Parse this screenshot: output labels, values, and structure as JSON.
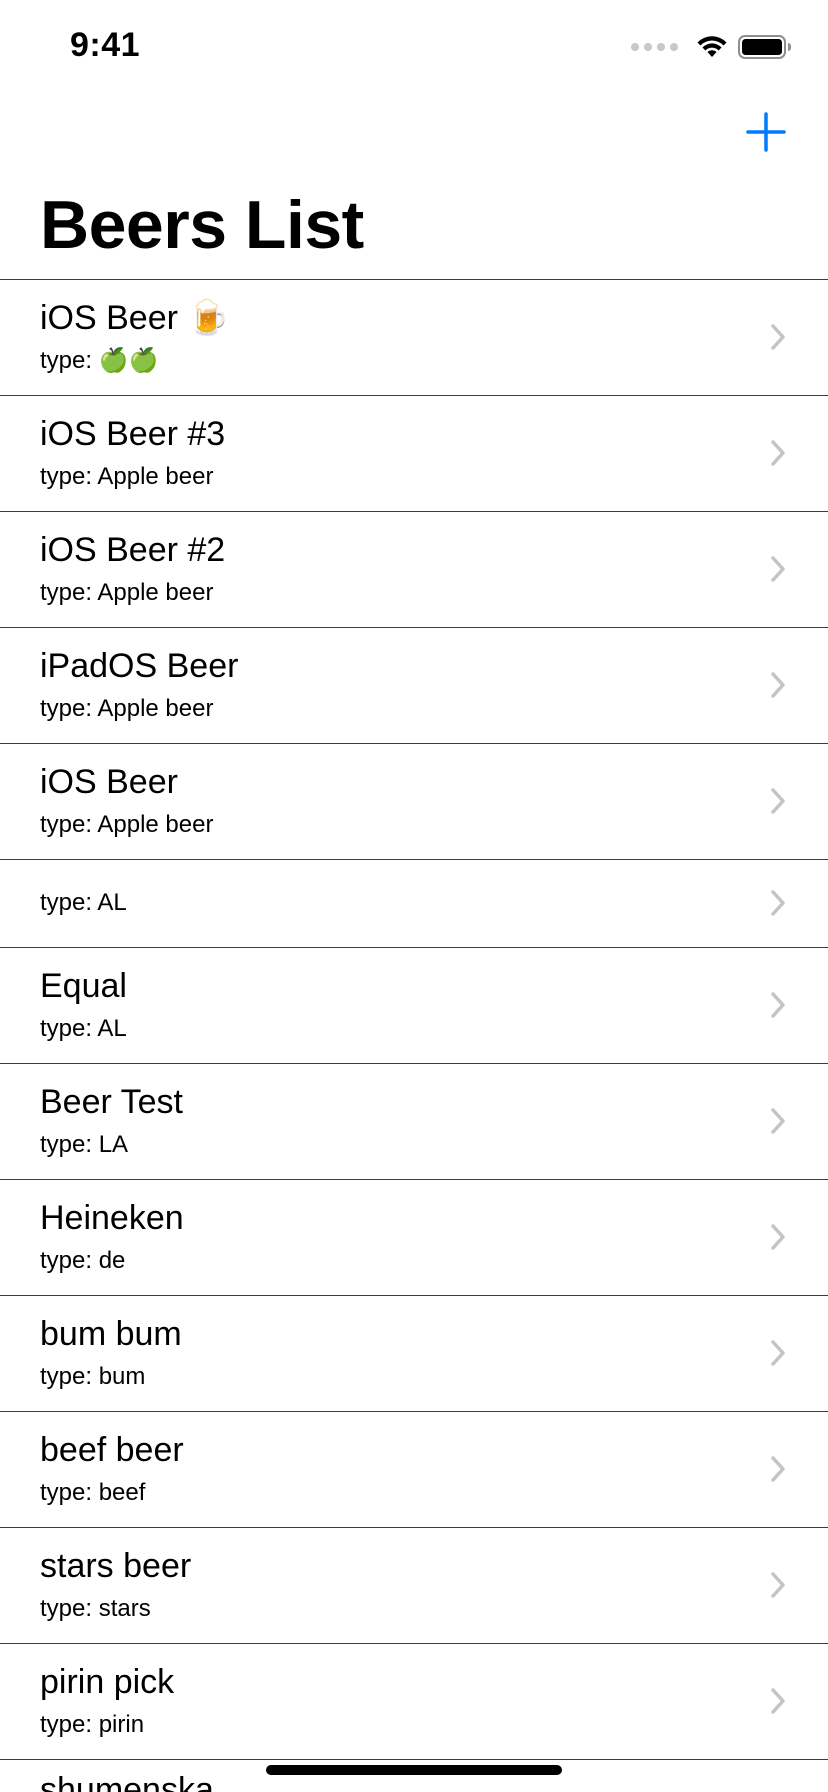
{
  "status_bar": {
    "time": "9:41"
  },
  "nav": {
    "title": "Beers List",
    "add_icon": "plus-icon",
    "accent_color": "#007aff"
  },
  "list": {
    "items": [
      {
        "title": "iOS Beer 🍺",
        "subtitle": "type: 🍏🍏"
      },
      {
        "title": "iOS Beer #3",
        "subtitle": "type: Apple beer"
      },
      {
        "title": "iOS Beer #2",
        "subtitle": "type: Apple beer"
      },
      {
        "title": "iPadOS Beer",
        "subtitle": "type: Apple beer"
      },
      {
        "title": "iOS Beer",
        "subtitle": "type: Apple beer"
      },
      {
        "title": "",
        "subtitle": "type: AL"
      },
      {
        "title": "Equal",
        "subtitle": "type: AL"
      },
      {
        "title": "Beer Test",
        "subtitle": "type: LA"
      },
      {
        "title": "Heineken",
        "subtitle": "type: de"
      },
      {
        "title": "bum bum",
        "subtitle": "type: bum"
      },
      {
        "title": "beef beer",
        "subtitle": "type: beef"
      },
      {
        "title": "stars beer",
        "subtitle": "type: stars"
      },
      {
        "title": "pirin pick",
        "subtitle": "type: pirin"
      }
    ],
    "peek_title": "shumenska"
  }
}
